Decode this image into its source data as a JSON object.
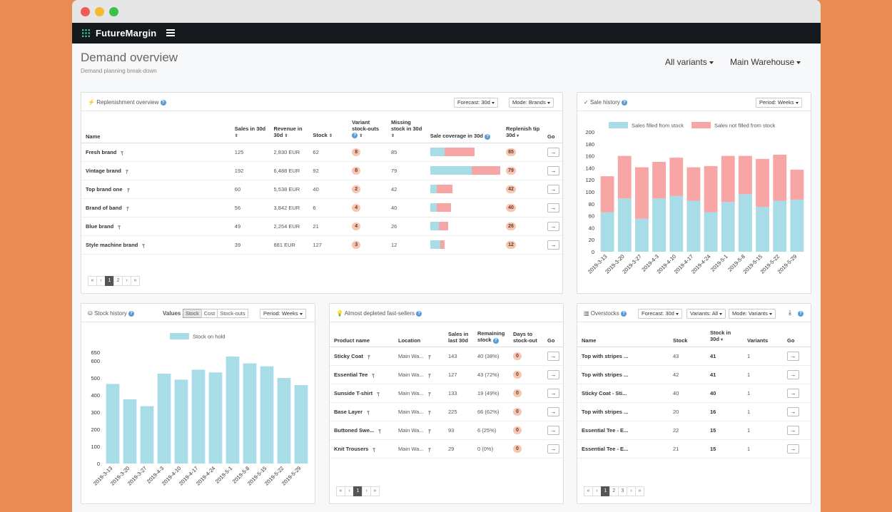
{
  "app": {
    "name": "FutureMargin"
  },
  "header": {
    "title": "Demand overview",
    "subtitle": "Demand planning break-down",
    "variants_dd": "All variants",
    "warehouse_dd": "Main Warehouse"
  },
  "replenishment": {
    "title": "Replenishment overview",
    "forecast_dd": "Forecast: 30d",
    "mode_dd": "Mode: Brands",
    "columns": {
      "name": "Name",
      "sales": "Sales in 30d",
      "revenue": "Revenue in 30d",
      "stock": "Stock",
      "stockouts": "Variant stock-outs",
      "missing": "Missing stock in 30d",
      "coverage": "Sale coverage in 30d",
      "tip": "Replenish tip 30d",
      "go": "Go"
    },
    "rows": [
      {
        "name": "Fresh brand",
        "sales": "125",
        "revenue": "2,830 EUR",
        "stock": "62",
        "stockouts": "8",
        "missing": "85",
        "cov_stock": 20,
        "cov_missing": 42,
        "tip": "85"
      },
      {
        "name": "Vintage brand",
        "sales": "192",
        "revenue": "6,488 EUR",
        "stock": "92",
        "stockouts": "8",
        "missing": "79",
        "cov_stock": 58,
        "cov_missing": 40,
        "tip": "79"
      },
      {
        "name": "Top brand one",
        "sales": "60",
        "revenue": "5,538 EUR",
        "stock": "40",
        "stockouts": "2",
        "missing": "42",
        "cov_stock": 9,
        "cov_missing": 22,
        "tip": "42"
      },
      {
        "name": "Brand of band",
        "sales": "56",
        "revenue": "3,842 EUR",
        "stock": "6",
        "stockouts": "4",
        "missing": "40",
        "cov_stock": 9,
        "cov_missing": 20,
        "tip": "40"
      },
      {
        "name": "Blue brand",
        "sales": "49",
        "revenue": "2,254 EUR",
        "stock": "21",
        "stockouts": "4",
        "missing": "26",
        "cov_stock": 12,
        "cov_missing": 13,
        "tip": "26"
      },
      {
        "name": "Style machine brand",
        "sales": "39",
        "revenue": "881 EUR",
        "stock": "127",
        "stockouts": "3",
        "missing": "12",
        "cov_stock": 14,
        "cov_missing": 6,
        "tip": "12"
      }
    ],
    "pager": {
      "first": "«",
      "prev": "‹",
      "p1": "1",
      "p2": "2",
      "next": "›",
      "last": "»"
    }
  },
  "sale_history": {
    "title": "Sale history",
    "period_dd": "Period: Weeks",
    "chart_data": {
      "type": "bar",
      "stacked": true,
      "categories": [
        "2019-3-13",
        "2019-3-20",
        "2019-3-27",
        "2019-4-3",
        "2019-4-10",
        "2019-4-17",
        "2019-4-24",
        "2019-5-1",
        "2019-5-8",
        "2019-5-15",
        "2019-5-22",
        "2019-5-29"
      ],
      "series": [
        {
          "name": "Sales filled from stock",
          "color": "#A8DCE7",
          "values": [
            66,
            89,
            55,
            89,
            93,
            85,
            66,
            83,
            96,
            75,
            85,
            87
          ]
        },
        {
          "name": "Sales not filled from stock",
          "color": "#F8A5A5",
          "values": [
            60,
            71,
            86,
            61,
            64,
            56,
            77,
            77,
            64,
            80,
            77,
            50
          ]
        }
      ],
      "ylim": [
        0,
        200
      ],
      "yticks": [
        "0",
        "20",
        "40",
        "60",
        "80",
        "100",
        "120",
        "140",
        "160",
        "180",
        "200"
      ],
      "legend": "top"
    }
  },
  "stock_history": {
    "title": "Stock history",
    "values_label": "Values",
    "seg": {
      "stock": "Stock",
      "cost": "Cost",
      "stockouts": "Stock-outs"
    },
    "period_dd": "Period: Weeks",
    "chart_data": {
      "type": "bar",
      "categories": [
        "2019-3-13",
        "2019-3-20",
        "2019-3-27",
        "2019-4-3",
        "2019-4-10",
        "2019-4-17",
        "2019-4-24",
        "2019-5-1",
        "2019-5-8",
        "2019-5-15",
        "2019-5-22",
        "2019-5-29"
      ],
      "series": [
        {
          "name": "Stock on hold",
          "color": "#A8DCE7",
          "values": [
            465,
            375,
            335,
            525,
            490,
            548,
            532,
            625,
            585,
            568,
            500,
            458
          ]
        }
      ],
      "ylim": [
        0,
        650
      ],
      "yticks": [
        "0",
        "100",
        "200",
        "300",
        "400",
        "500",
        "600",
        "650"
      ],
      "legend": "top"
    }
  },
  "depleted": {
    "title": "Almost depleted fast-sellers",
    "columns": {
      "product": "Product name",
      "location": "Location",
      "sales": "Sales in last 30d",
      "remaining": "Remaining stock",
      "days": "Days to stock-out",
      "go": "Go"
    },
    "rows": [
      {
        "product": "Sticky Coat",
        "location": "Main Wa...",
        "sales": "143",
        "remaining": "40 (38%)",
        "days": "0"
      },
      {
        "product": "Essential Tee",
        "location": "Main Wa...",
        "sales": "127",
        "remaining": "43 (72%)",
        "days": "0"
      },
      {
        "product": "Sunside T-shirt",
        "location": "Main Wa...",
        "sales": "133",
        "remaining": "19 (49%)",
        "days": "0"
      },
      {
        "product": "Base Layer",
        "location": "Main Wa...",
        "sales": "225",
        "remaining": "66 (62%)",
        "days": "0"
      },
      {
        "product": "Buttoned Swe...",
        "location": "Main Wa...",
        "sales": "93",
        "remaining": "6 (25%)",
        "days": "0"
      },
      {
        "product": "Knit Trousers",
        "location": "Main Wa...",
        "sales": "29",
        "remaining": "0 (0%)",
        "days": "0"
      }
    ],
    "pager": {
      "first": "«",
      "prev": "‹",
      "p1": "1",
      "next": "›",
      "last": "»"
    }
  },
  "overstocks": {
    "title": "Overstocks",
    "forecast_dd": "Forecast: 30d",
    "variants_dd": "Variants: All",
    "mode_dd": "Mode: Variants",
    "columns": {
      "name": "Name",
      "stock": "Stock",
      "stock30": "Stock in 30d",
      "variants": "Variants",
      "go": "Go"
    },
    "rows": [
      {
        "name": "Top with stripes ...",
        "stock": "43",
        "stock30": "41",
        "variants": "1"
      },
      {
        "name": "Top with stripes ...",
        "stock": "42",
        "stock30": "41",
        "variants": "1"
      },
      {
        "name": "Sticky Coat - Sti...",
        "stock": "40",
        "stock30": "40",
        "variants": "1"
      },
      {
        "name": "Top with stripes ...",
        "stock": "20",
        "stock30": "16",
        "variants": "1"
      },
      {
        "name": "Essential Tee - E...",
        "stock": "22",
        "stock30": "15",
        "variants": "1"
      },
      {
        "name": "Essential Tee - E...",
        "stock": "21",
        "stock30": "15",
        "variants": "1"
      }
    ],
    "pager": {
      "first": "«",
      "prev": "‹",
      "p1": "1",
      "p2": "2",
      "p3": "3",
      "next": "›",
      "last": "»"
    }
  },
  "go_arrow": "→",
  "help_glyph": "?"
}
